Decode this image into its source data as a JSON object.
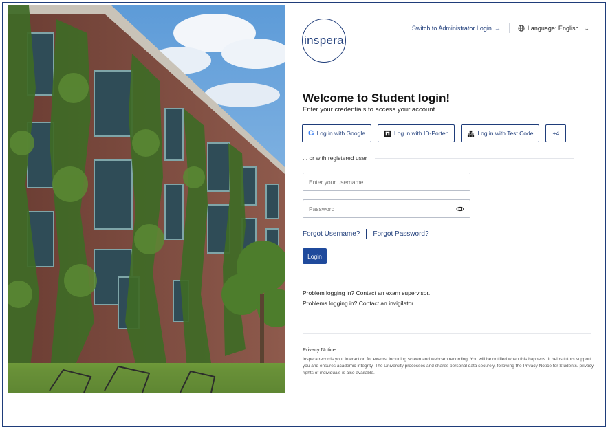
{
  "brand": {
    "logo_text": "inspera"
  },
  "header": {
    "admin_link": "Switch to Administrator Login",
    "admin_arrow": "→",
    "language_label": "Language: English",
    "language_chevron": "⌄"
  },
  "login": {
    "title": "Welcome to Student login!",
    "subtitle": "Enter your credentials to access your account",
    "sso": {
      "google": "Log in with Google",
      "idporten": "Log in with ID-Porten",
      "testcode": "Log in with Test Code",
      "more": "+4"
    },
    "divider": "... or with registered user",
    "username_placeholder": "Enter your username",
    "password_placeholder": "Password",
    "forgot_username": "Forgot Username?",
    "forgot_password": "Forgot Password?",
    "login_button": "Login"
  },
  "help": {
    "line1": "Problem logging in? Contact an exam supervisor.",
    "line2": "Problems logging in? Contact an invigilator."
  },
  "privacy": {
    "title": "Privacy Notice",
    "text": "Inspera records your interaction for exams, including screen and webcam recording. You will be notified when this happens. It helps tutors support you and ensures academic integrity. The University processes and shares personal data securely, following the Privacy Notice for Students.  privacy rights of individuals is also available."
  },
  "icons": {
    "google": "google-icon",
    "idporten": "id-porten-icon",
    "testcode": "test-code-icon",
    "globe": "globe-icon",
    "eye": "eye-icon"
  },
  "colors": {
    "brand_navy": "#1f3d7a",
    "button_blue": "#1f4a9c"
  }
}
